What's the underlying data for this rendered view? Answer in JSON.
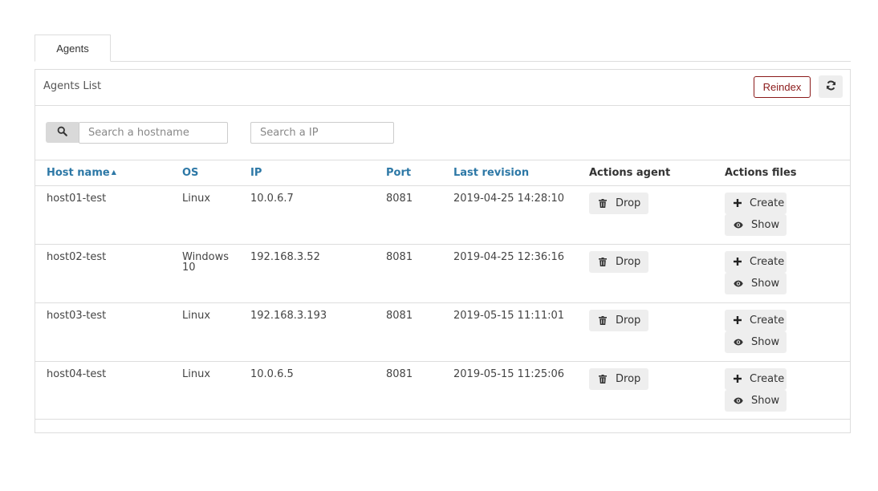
{
  "tabs": [
    {
      "label": "Agents",
      "active": true
    }
  ],
  "panel": {
    "title": "Agents List",
    "reindex_label": "Reindex",
    "accent": "#8b1a1a"
  },
  "search": {
    "hostname_placeholder": "Search a hostname",
    "hostname_value": "",
    "ip_placeholder": "Search a IP",
    "ip_value": ""
  },
  "table": {
    "headers": {
      "hostname": "Host name",
      "os": "OS",
      "ip": "IP",
      "port": "Port",
      "last_revision": "Last revision",
      "actions_agent": "Actions agent",
      "actions_files": "Actions files"
    },
    "sort": {
      "column": "hostname",
      "direction": "asc"
    },
    "header_link_color": "#2d78a6",
    "rows": [
      {
        "hostname": "host01-test",
        "os": "Linux",
        "ip": "10.0.6.7",
        "port": "8081",
        "last_revision": "2019-04-25 14:28:10"
      },
      {
        "hostname": "host02-test",
        "os": "Windows 10",
        "ip": "192.168.3.52",
        "port": "8081",
        "last_revision": "2019-04-25 12:36:16"
      },
      {
        "hostname": "host03-test",
        "os": "Linux",
        "ip": "192.168.3.193",
        "port": "8081",
        "last_revision": "2019-05-15 11:11:01"
      },
      {
        "hostname": "host04-test",
        "os": "Linux",
        "ip": "10.0.6.5",
        "port": "8081",
        "last_revision": "2019-05-15 11:25:06"
      }
    ],
    "actions": {
      "drop_label": "Drop",
      "create_label": "Create",
      "show_label": "Show"
    }
  },
  "icons": {
    "search": "search-icon",
    "refresh": "refresh-icon",
    "drop": "trash-icon",
    "create": "plus-icon",
    "show": "eye-icon",
    "sort": "caret-up-icon"
  }
}
